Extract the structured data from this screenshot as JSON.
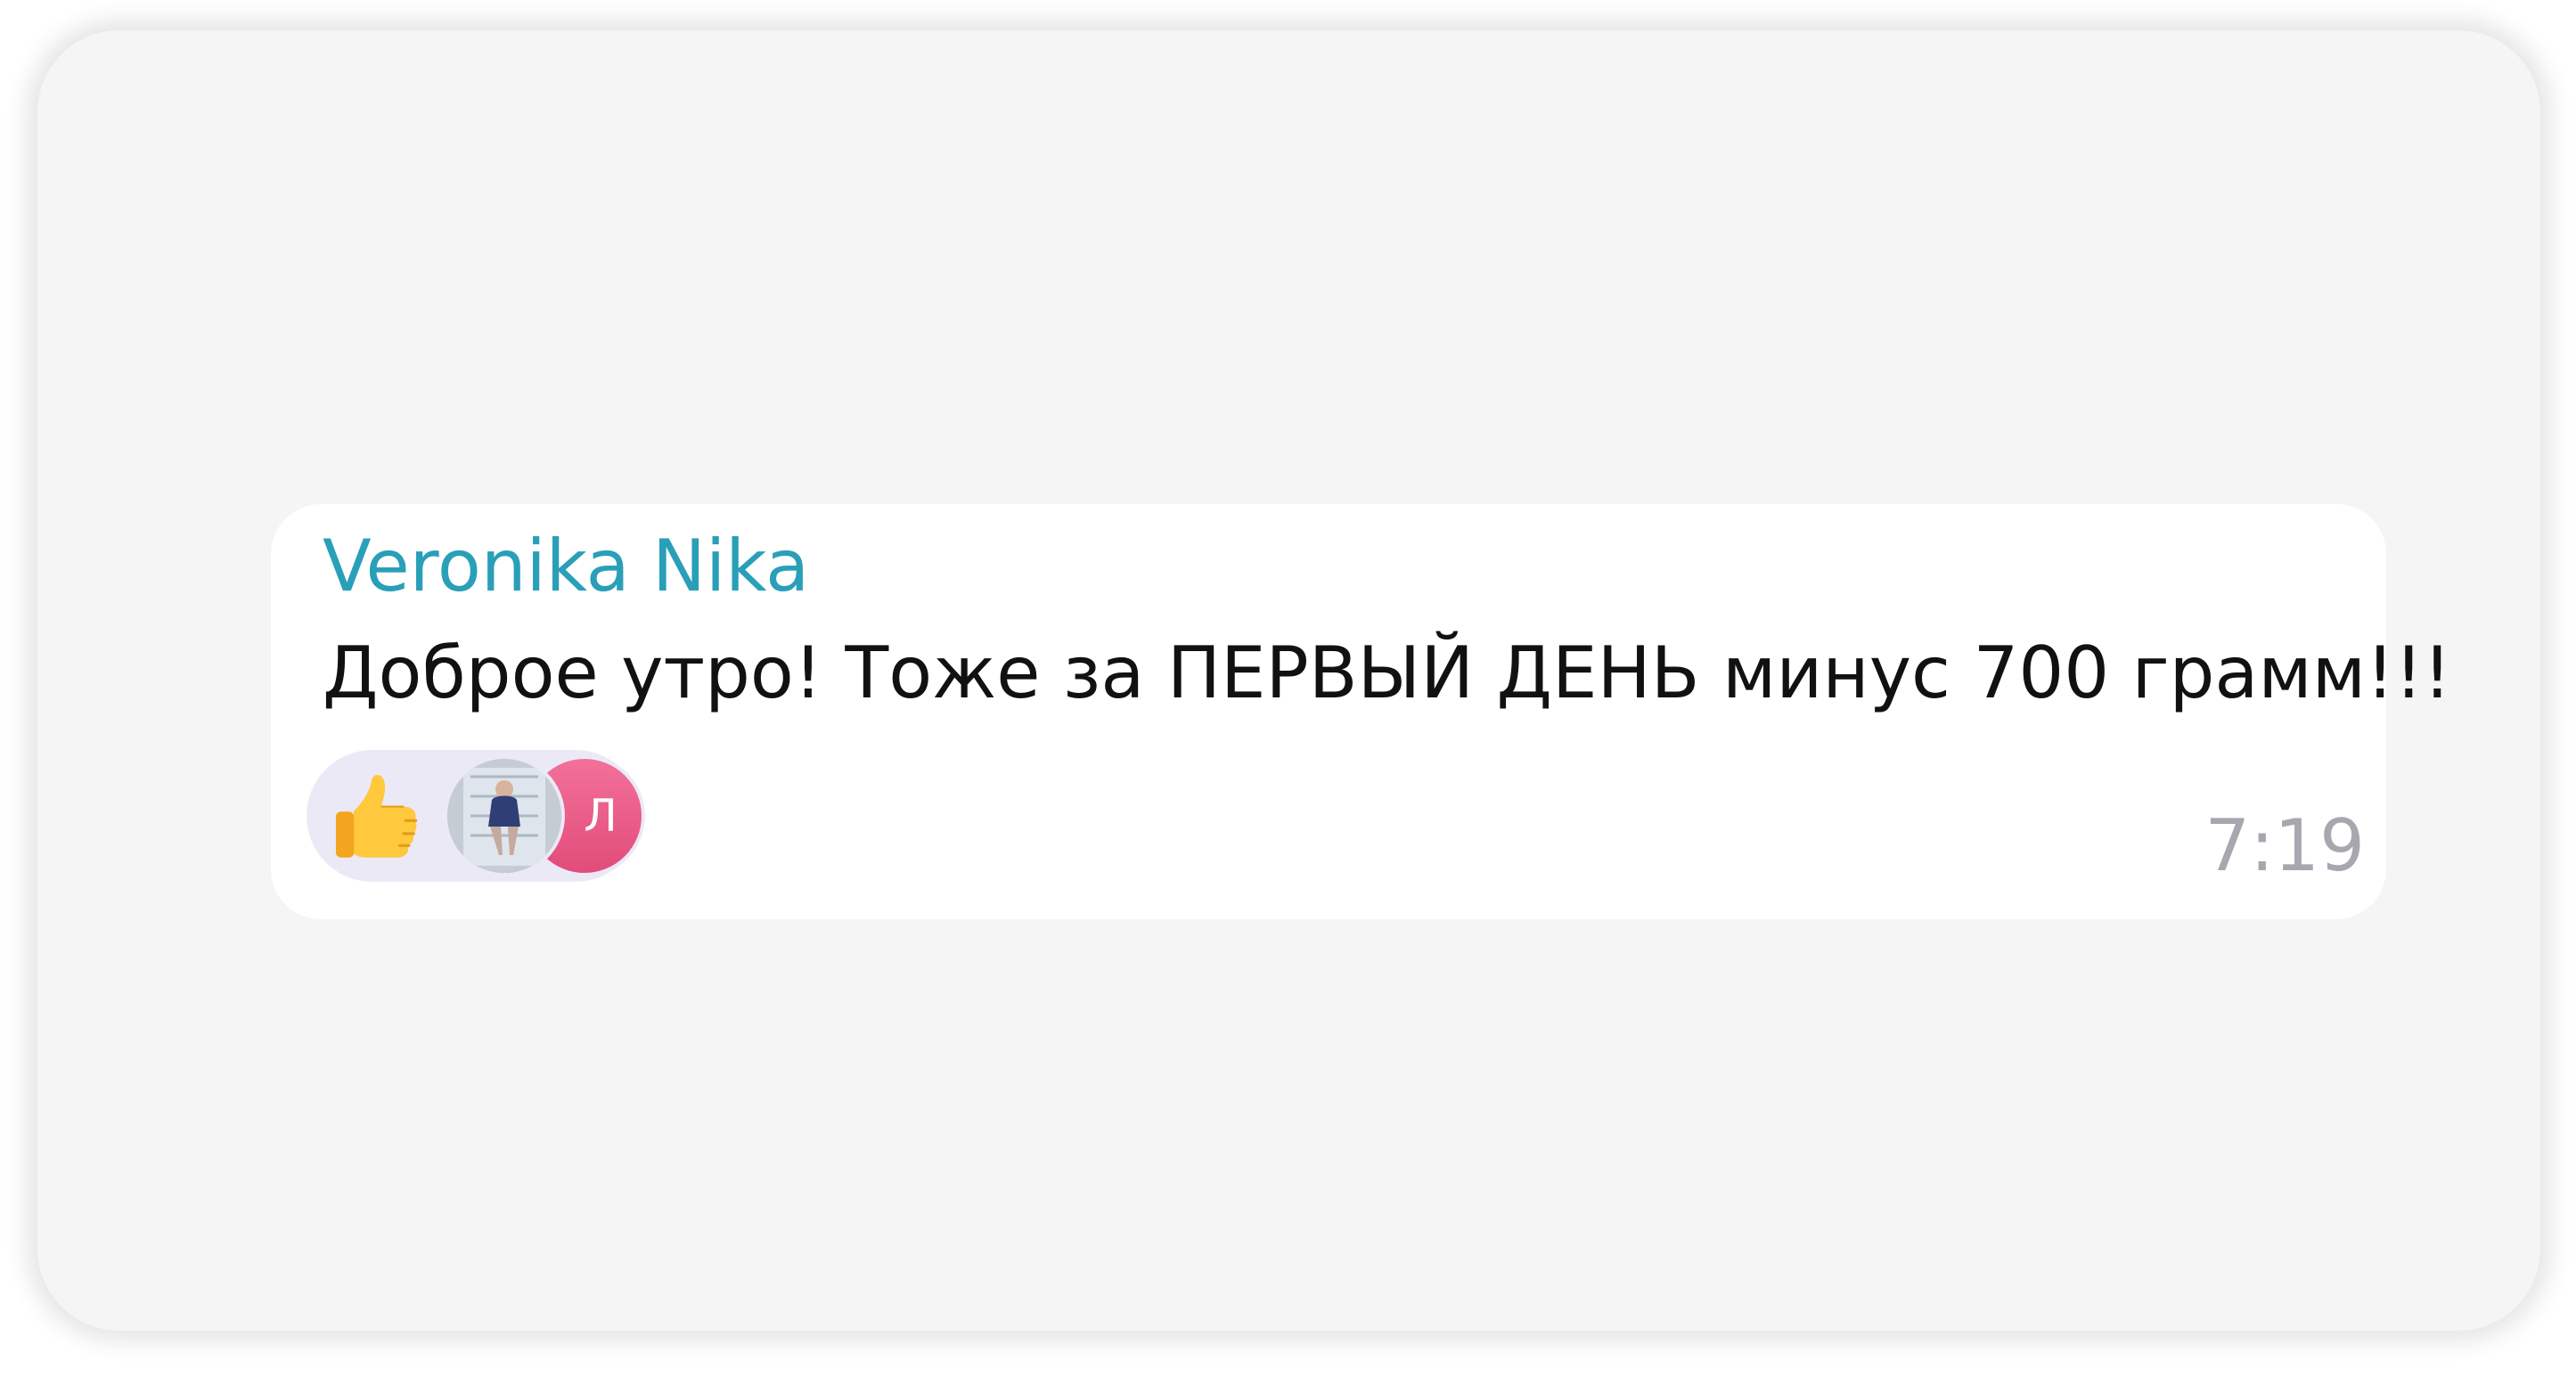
{
  "chat": {
    "sender_name": "Veronika Nika",
    "message_text": "Доброе утро! Тоже за ПЕРВЫЙ ДЕНЬ минус 700 грамм!!!",
    "time": "7:19",
    "reaction": {
      "emoji": "thumbs-up",
      "reactor_avatar_letter": "Л"
    }
  },
  "colors": {
    "sender_name": "#2a9fb8",
    "reaction_background": "#ece9f7",
    "letter_avatar": "#e24c79",
    "time": "#a7a7af"
  }
}
